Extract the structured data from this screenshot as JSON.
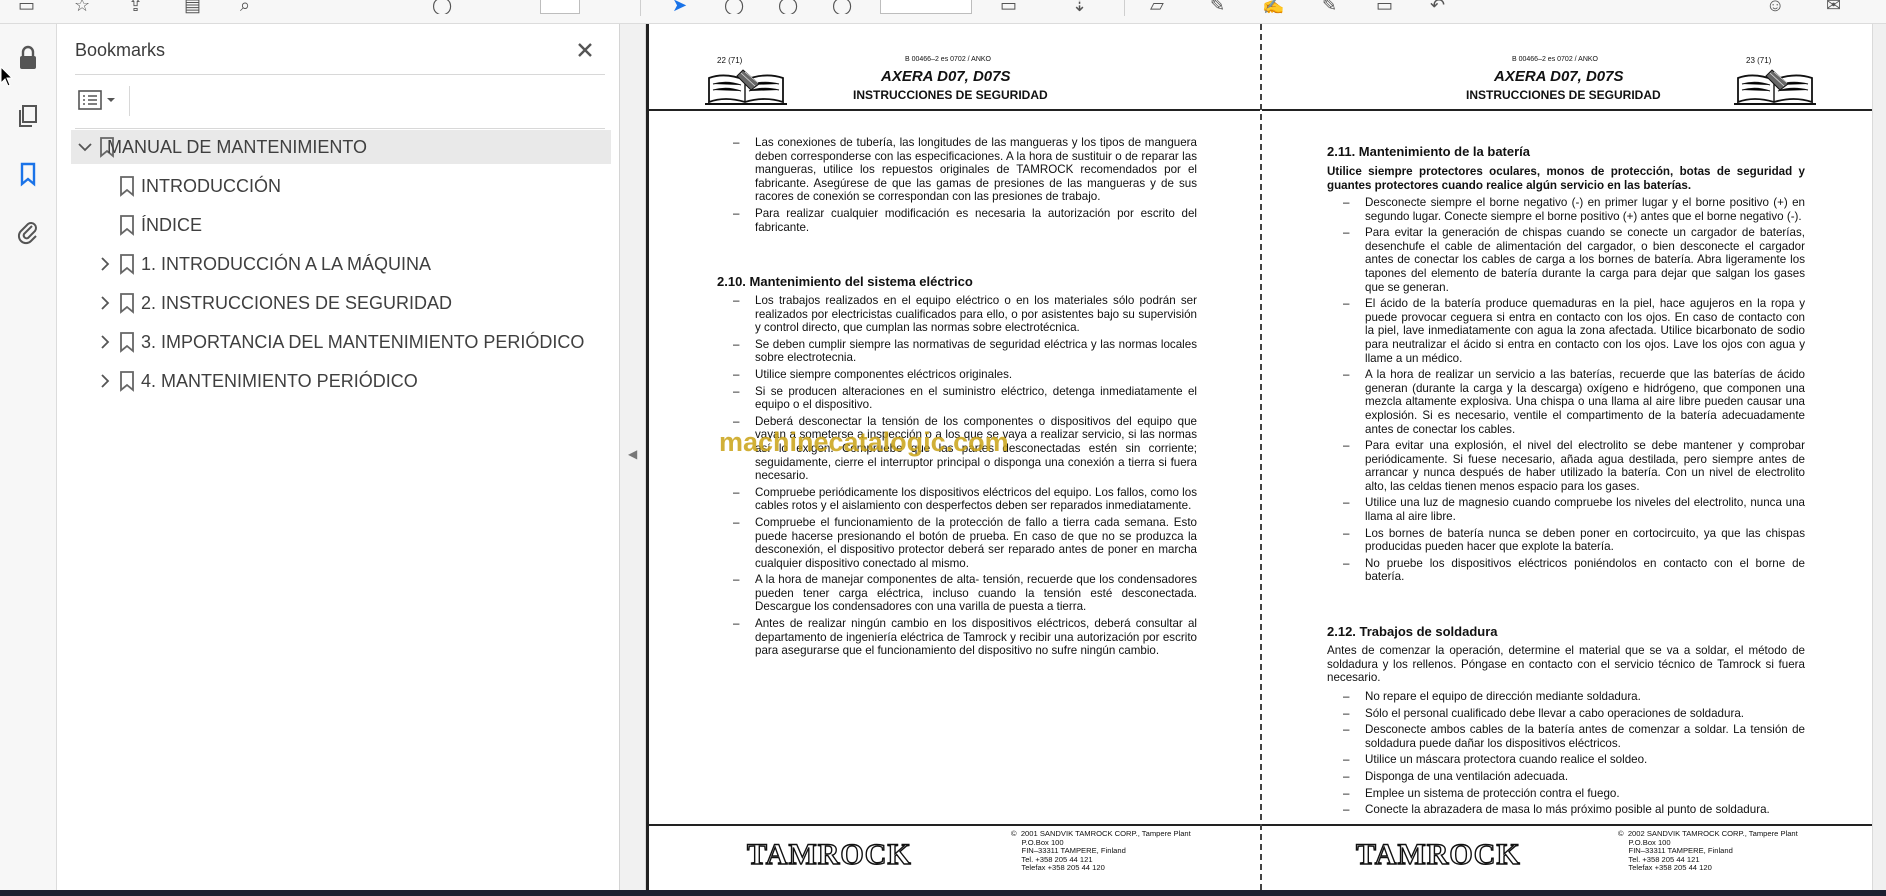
{
  "panel": {
    "title": "Bookmarks",
    "bookmarks": [
      {
        "label": "MANUAL DE MANTENIMIENTO",
        "level": 0,
        "expandable": true,
        "expanded": true,
        "selected": true
      },
      {
        "label": "INTRODUCCIÓN",
        "level": 1,
        "expandable": false
      },
      {
        "label": "ÍNDICE",
        "level": 1,
        "expandable": false
      },
      {
        "label": "1. INTRODUCCIÓN A LA MÁQUINA",
        "level": 1,
        "expandable": true
      },
      {
        "label": "2. INSTRUCCIONES DE SEGURIDAD",
        "level": 1,
        "expandable": true
      },
      {
        "label": "3. IMPORTANCIA DEL MANTENIMIENTO PERIÓDICO",
        "level": 1,
        "expandable": true
      },
      {
        "label": "4. MANTENIMIENTO PERIÓDICO",
        "level": 1,
        "expandable": true
      }
    ]
  },
  "rail_icons": [
    "lock-icon",
    "pages-icon",
    "bookmark-icon",
    "attachment-icon"
  ],
  "document": {
    "watermark": "machinecatalogic.com",
    "left_page": {
      "page_number": "22 (71)",
      "doc_code": "B 00466–2 es 0702 / ANKO",
      "title": "AXERA D07, D07S",
      "subtitle": "INSTRUCCIONES DE SEGURIDAD",
      "top_bullets": [
        "Las conexiones de tubería, las longitudes de las mangueras y los tipos de manguera deben corresponderse con las especificaciones. A la hora de sustituir o de reparar las mangueras, utilice los repuestos originales de TAMROCK recomendados por el fabricante. Asegúrese de que las gamas de presiones de las mangueras y de sus racores de conexión se correspondan con las presiones de trabajo.",
        "Para realizar cualquier modificación es necesaria la autorización por escrito del fabricante."
      ],
      "section_title": "2.10.  Mantenimiento del sistema eléctrico",
      "section_bullets": [
        "Los trabajos realizados en el equipo eléctrico o en los materiales sólo podrán ser realizados por electricistas cualificados para ello, o por asistentes bajo su supervisión y control directo, que cumplan las normas sobre electrotécnica.",
        "Se deben cumplir siempre las normativas de seguridad eléctrica y las normas locales sobre electrotecnia.",
        "Utilice siempre componentes eléctricos originales.",
        "Si se producen alteraciones en el suministro eléctrico, detenga inmediatamente el equipo o el dispositivo.",
        "Deberá desconectar la tensión de los componentes o dispositivos del equipo que vayan a someterse a inspección o a los que se vaya a realizar servicio, si las normas así lo exigen. Compruebe que las partes desconectadas estén sin corriente; seguidamente, cierre el interruptor principal o disponga una conexión a tierra si fuera necesario.",
        "Compruebe periódicamente los dispositivos eléctricos del equipo. Los fallos, como los cables rotos y el aislamiento con desperfectos deben ser reparados inmediatamente.",
        "Compruebe el funcionamiento de la protección de fallo a tierra cada semana. Esto puede hacerse presionando el botón de prueba. En caso de que no se produzca la desconexión, el dispositivo protector deberá ser reparado antes de poner en marcha cualquier dispositivo conectado al mismo.",
        "A la hora de manejar componentes de alta- tensión, recuerde que los condensadores pueden tener carga eléctrica, incluso cuando la tensión esté desconectada. Descargue los condensadores con una varilla de puesta a tierra.",
        "Antes de realizar ningún cambio en los dispositivos eléctricos, deberá consultar al departamento de ingeniería eléctrica de Tamrock y recibir una autorización por escrito para asegurarse que el funcionamiento del dispositivo no sufre ningún cambio."
      ],
      "footer_logo": "TAMROCK",
      "footer_address": "©  2001 SANDVIK TAMROCK CORP., Tampere Plant\n     P.O.Box 100\n     FIN–33311 TAMPERE, Finland\n     Tel. +358 205 44 121\n     Telefax +358 205 44 120"
    },
    "right_page": {
      "page_number": "23 (71)",
      "doc_code": "B 00466–2 es 0702 / ANKO",
      "title": "AXERA D07, D07S",
      "subtitle": "INSTRUCCIONES DE SEGURIDAD",
      "section1_title": "2.11.  Mantenimiento de la batería",
      "section1_lead": "Utilice siempre protectores oculares, monos de protección, botas de seguridad y guantes protectores cuando realice algún servicio en las baterías.",
      "section1_bullets": [
        "Desconecte siempre el borne negativo (-)  en primer lugar y el borne positivo (+) en segundo lugar. Conecte siempre el borne positivo (+)  antes que el borne negativo (-).",
        "Para evitar la generación de chispas cuando se conecte un cargador de baterías, desenchufe el cable de alimentación del cargador, o bien desconecte el cargador antes de conectar los cables de carga a los bornes de batería. Abra ligeramente los tapones del elemento de batería durante la carga para dejar que salgan los gases que se generan.",
        "El ácido de la batería produce quemaduras en la piel, hace agujeros en la ropa y puede provocar ceguera si entra en contacto con los ojos. En caso de contacto con la piel, lave inmediatamente con agua la zona afectada. Utilice bicarbonato de sodio para neutralizar el ácido si entra en contacto con los ojos. Lave los ojos con agua y llame a un médico.",
        "A la hora de realizar un servicio a las baterías, recuerde que las baterías de ácido generan (durante la carga y la descarga) oxígeno e hidrógeno, que componen una mezcla altamente explosiva. Una chispa o una llama al aire libre pueden causar una explosión. Si es necesario, ventile el compartimento de la batería adecuadamente antes de conectar los cables.",
        "Para evitar una explosión, el nivel del electrolito se debe mantener y comprobar periódicamente. Si fuese necesario, añada agua destilada, pero siempre antes de arrancar y nunca después de haber utilizado la batería. Con un nivel de electrolito alto, las celdas tienen menos espacio para los gases.",
        "Utilice una luz de magnesio cuando compruebe los niveles del electrolito, nunca una llama al aire libre.",
        "Los bornes de batería nunca se deben poner en cortocircuito, ya que las chispas producidas pueden hacer que explote la batería.",
        "No pruebe los dispositivos eléctricos poniéndolos en contacto con el borne de batería."
      ],
      "section2_title": "2.12.  Trabajos de soldadura",
      "section2_lead": "Antes de comenzar la operación, determine el material que se va a soldar, el método de soldadura y los rellenos. Póngase en contacto con el servicio técnico de Tamrock si fuera necesario.",
      "section2_bullets": [
        "No repare el equipo de dirección mediante soldadura.",
        "Sólo el personal cualificado debe llevar a cabo operaciones de soldadura.",
        "Desconecte ambos cables de la batería antes de comenzar a soldar. La tensión de soldadura puede dañar los dispositivos eléctricos.",
        "Utilice un máscara protectora cuando realice el soldeo.",
        "Disponga de una ventilación adecuada.",
        "Emplee un sistema de protección contra el fuego.",
        "Conecte la abrazadera de masa lo más próximo posible al punto de soldadura."
      ],
      "footer_logo": "TAMROCK",
      "footer_address": "©  2002 SANDVIK TAMROCK CORP., Tampere Plant\n     P.O.Box 100\n     FIN–33311 TAMPERE, Finland\n     Tel. +358 205 44 121\n     Telefax +358 205 44 120"
    }
  }
}
